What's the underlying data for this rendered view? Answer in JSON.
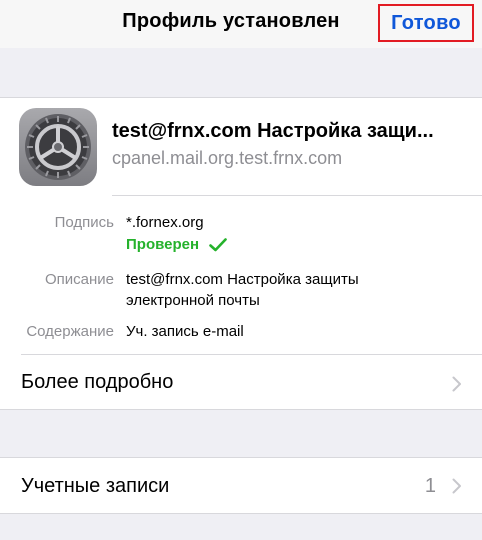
{
  "navbar": {
    "title": "Профиль установлен",
    "done_label": "Готово"
  },
  "profile": {
    "icon": "settings-gear-icon",
    "name": "test@frnx.com Настройка защи...",
    "host": "cpanel.mail.org.test.frnx.com",
    "details": {
      "signature_label": "Подпись",
      "signature_value": "*.fornex.org",
      "verified_label": "Проверен",
      "description_label": "Описание",
      "description_value": "test@frnx.com Настройка защиты электронной почты",
      "contents_label": "Содержание",
      "contents_value": "Уч. запись e-mail"
    },
    "more_label": "Более подробно"
  },
  "accounts": {
    "label": "Учетные записи",
    "count": "1"
  },
  "colors": {
    "accent": "#0f57d9",
    "verified": "#25b22c",
    "highlight_border": "#e21b23",
    "secondary_text": "#8e8e93",
    "background": "#efeff4"
  }
}
